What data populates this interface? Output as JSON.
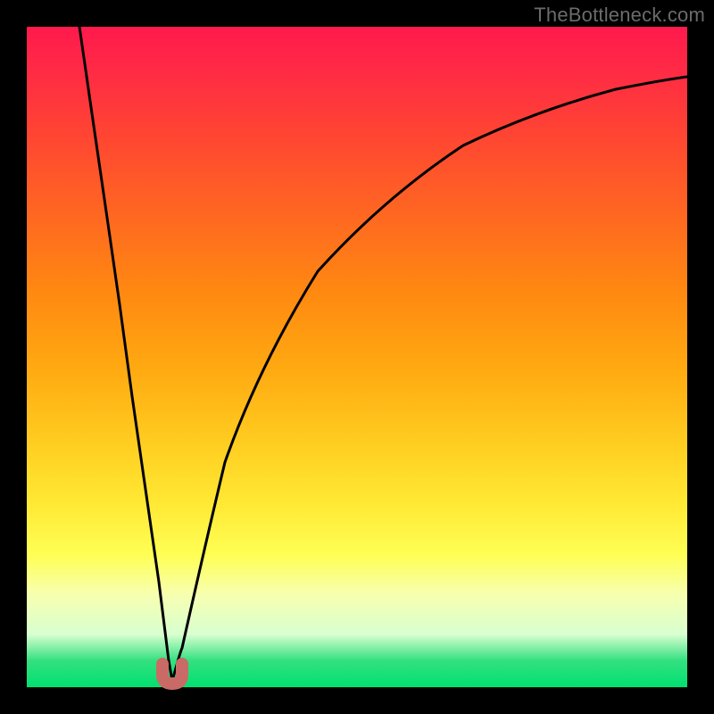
{
  "watermark": "TheBottleneck.com",
  "colors": {
    "frame": "#000000",
    "gradient_top": "#ff1a4d",
    "gradient_bottom": "#00e070",
    "curve": "#000000",
    "tip": "#c96a66"
  },
  "chart_data": {
    "type": "line",
    "title": "",
    "xlabel": "",
    "ylabel": "",
    "xlim": [
      0,
      1
    ],
    "ylim": [
      0,
      1
    ],
    "cusp_x": 0.22,
    "series": [
      {
        "name": "left-branch",
        "x": [
          0.08,
          0.1,
          0.12,
          0.14,
          0.16,
          0.18,
          0.2,
          0.215,
          0.22
        ],
        "y": [
          1.0,
          0.86,
          0.72,
          0.58,
          0.44,
          0.3,
          0.16,
          0.04,
          0.01
        ]
      },
      {
        "name": "right-branch",
        "x": [
          0.22,
          0.235,
          0.26,
          0.3,
          0.36,
          0.44,
          0.54,
          0.66,
          0.8,
          0.94,
          1.0
        ],
        "y": [
          0.01,
          0.06,
          0.18,
          0.34,
          0.5,
          0.63,
          0.74,
          0.82,
          0.88,
          0.91,
          0.925
        ]
      }
    ],
    "tip_marker": {
      "shape": "u",
      "x": 0.22,
      "y": 0.015,
      "color": "#c96a66"
    }
  }
}
